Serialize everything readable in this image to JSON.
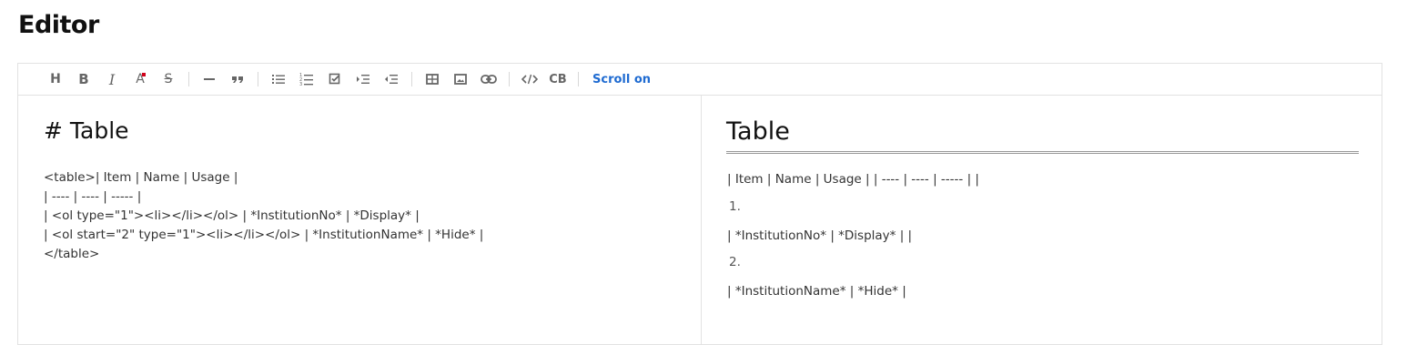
{
  "page": {
    "title": "Editor"
  },
  "toolbar": {
    "buttons": [
      {
        "name": "heading",
        "label": "H"
      },
      {
        "name": "bold",
        "label": "B"
      },
      {
        "name": "italic",
        "label": "I"
      },
      {
        "name": "font-color",
        "label": "A"
      },
      {
        "name": "strikethrough",
        "label": "S"
      },
      {
        "name": "horizontal-rule"
      },
      {
        "name": "blockquote"
      },
      {
        "name": "bullet-list"
      },
      {
        "name": "ordered-list"
      },
      {
        "name": "task-list"
      },
      {
        "name": "indent"
      },
      {
        "name": "outdent"
      },
      {
        "name": "table"
      },
      {
        "name": "image"
      },
      {
        "name": "link"
      },
      {
        "name": "code"
      },
      {
        "name": "code-block",
        "label": "CB"
      }
    ],
    "scroll_toggle": "Scroll on",
    "accent_color": "#1f6bd1",
    "font_color_marker": "#d0021b"
  },
  "markdown": {
    "heading": "# Table",
    "lines": [
      "<table>| Item | Name | Usage |",
      "| ---- | ---- | ----- |",
      "| <ol type=\"1\"><li></li></ol> | *InstitutionNo* | *Display* |",
      "| <ol start=\"2\" type=\"1\"><li></li></ol> | *InstitutionName* | *Hide* |",
      "</table>"
    ]
  },
  "preview": {
    "heading": "Table",
    "row_header": "| Item | Name | Usage | | ---- | ---- | ----- | |",
    "item1_number": "1.",
    "row1": "| *InstitutionNo* | *Display* | |",
    "item2_number": "2.",
    "row2": "| *InstitutionName* | *Hide* |"
  }
}
